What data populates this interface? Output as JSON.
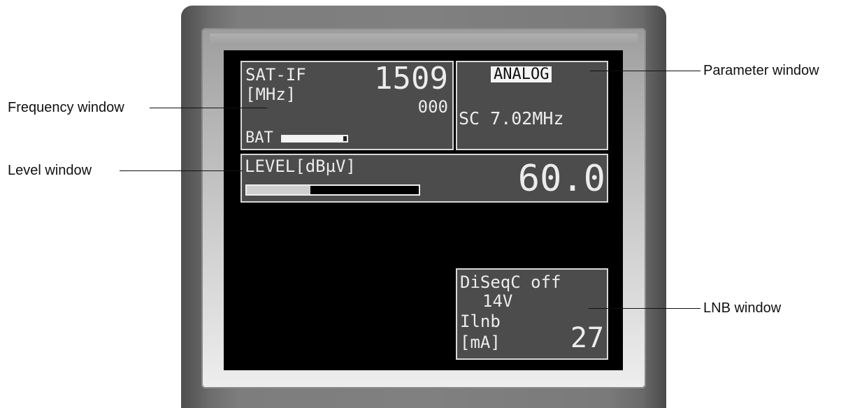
{
  "display": {
    "frequency": {
      "band_label": "SAT-IF",
      "unit_label": "[MHz]",
      "value": "1509",
      "sub_value": "000",
      "battery_label": "BAT",
      "battery_level": 0.95
    },
    "parameter": {
      "mode_label": "ANALOG",
      "subcarrier": "SC 7.02MHz"
    },
    "level": {
      "label": "LEVEL[dBµV]",
      "value": "60.0",
      "bar_level": 0.37
    },
    "lnb": {
      "diseqc": "DiSeqC off",
      "voltage": "14V",
      "current_label": "Ilnb",
      "current_unit": "[mA]",
      "current_value": "27"
    }
  },
  "callouts": {
    "parameter": "Parameter window",
    "frequency": "Frequency window",
    "level": "Level window",
    "lnb": "LNB window"
  }
}
